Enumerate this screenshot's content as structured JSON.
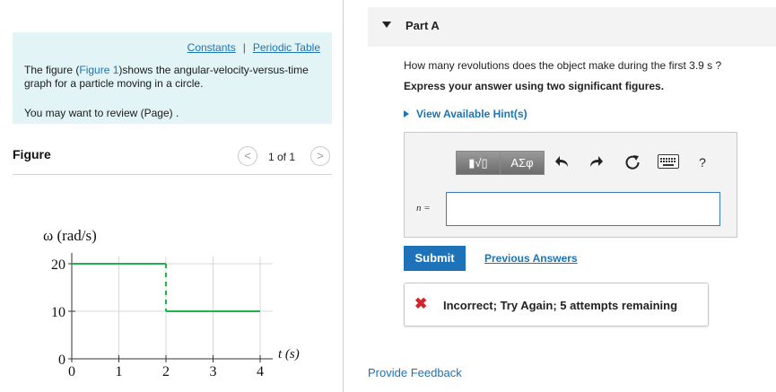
{
  "intro": {
    "constants_link": "Constants",
    "separator": "|",
    "periodic_table_link": "Periodic Table",
    "line_prefix": "The figure (",
    "figure_link": "Figure 1",
    "line_suffix": ")shows the angular-velocity-versus-time graph for a particle moving in a circle.",
    "review_text": "You may want to review (Page) ."
  },
  "figure": {
    "title": "Figure",
    "prev_symbol": "<",
    "next_symbol": ">",
    "page_count": "1 of 1"
  },
  "chart_data": {
    "type": "line",
    "ylabel": "ω (rad/s)",
    "xlabel": "t (s)",
    "xlim": [
      0,
      4
    ],
    "ylim": [
      0,
      20
    ],
    "x_ticks": [
      "0",
      "1",
      "2",
      "3",
      "4"
    ],
    "y_ticks": [
      "0",
      "10",
      "20"
    ],
    "grid": true,
    "series": [
      {
        "x": [
          0,
          2,
          2,
          4
        ],
        "y": [
          20,
          20,
          10,
          10
        ],
        "color": "#22b14c"
      }
    ]
  },
  "part": {
    "title": "Part A",
    "question": "How many revolutions does the object make during the first 3.9 s ?",
    "instruction": "Express your answer using two significant figures.",
    "hint_label": "View Available Hint(s)"
  },
  "answer": {
    "templates_label": "▮√▯",
    "symbols_label": "ΑΣφ",
    "undo_icon": "undo-icon",
    "redo_icon": "redo-icon",
    "reset_icon": "reset-icon",
    "keyboard_icon": "keyboard-icon",
    "help_label": "?",
    "variable_label": "n =",
    "input_value": ""
  },
  "actions": {
    "submit_label": "Submit",
    "previous_answers_label": "Previous Answers"
  },
  "feedback": {
    "icon": "✖",
    "message": "Incorrect; Try Again; 5 attempts remaining",
    "color": "#d3232b"
  },
  "footer": {
    "provide_feedback_label": "Provide Feedback"
  }
}
